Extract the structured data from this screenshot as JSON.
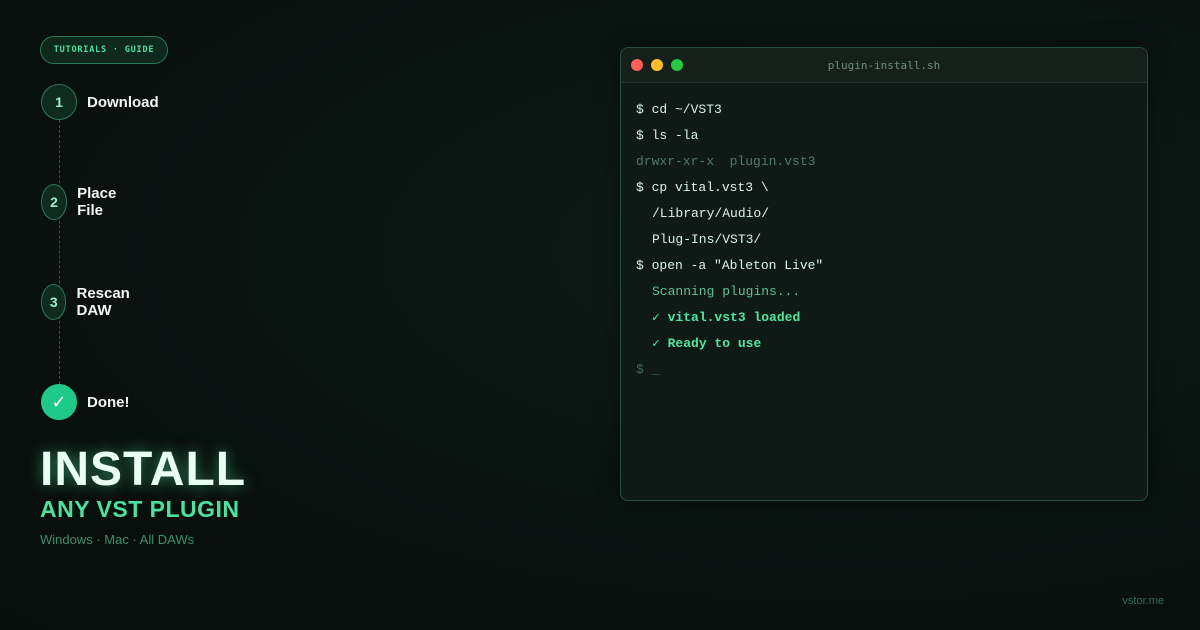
{
  "badge": "TUTORIALS · GUIDE",
  "steps": [
    {
      "marker": "1",
      "label": "Download"
    },
    {
      "marker": "2",
      "label": "Place File"
    },
    {
      "marker": "3",
      "label": "Rescan DAW"
    },
    {
      "marker": "✓",
      "label": "Done!"
    }
  ],
  "hero": {
    "title": "INSTALL",
    "subtitle": "ANY VST PLUGIN",
    "platforms": "Windows · Mac · All DAWs"
  },
  "terminal": {
    "title": "plugin-install.sh",
    "lines": [
      "$ cd ~/VST3",
      "$ ls -la",
      "drwxr-xr-x  plugin.vst3",
      "$ cp vital.vst3 \\",
      "/Library/Audio/",
      "Plug-Ins/VST3/",
      "$ open -a \"Ableton Live\"",
      "Scanning plugins...",
      "✓ vital.vst3 loaded",
      "✓ Ready to use",
      "$ _"
    ]
  },
  "footer": "vstor.me",
  "colors": {
    "accent": "#4fe0a0",
    "done": "#1fc98a",
    "background": "#0a1411"
  }
}
